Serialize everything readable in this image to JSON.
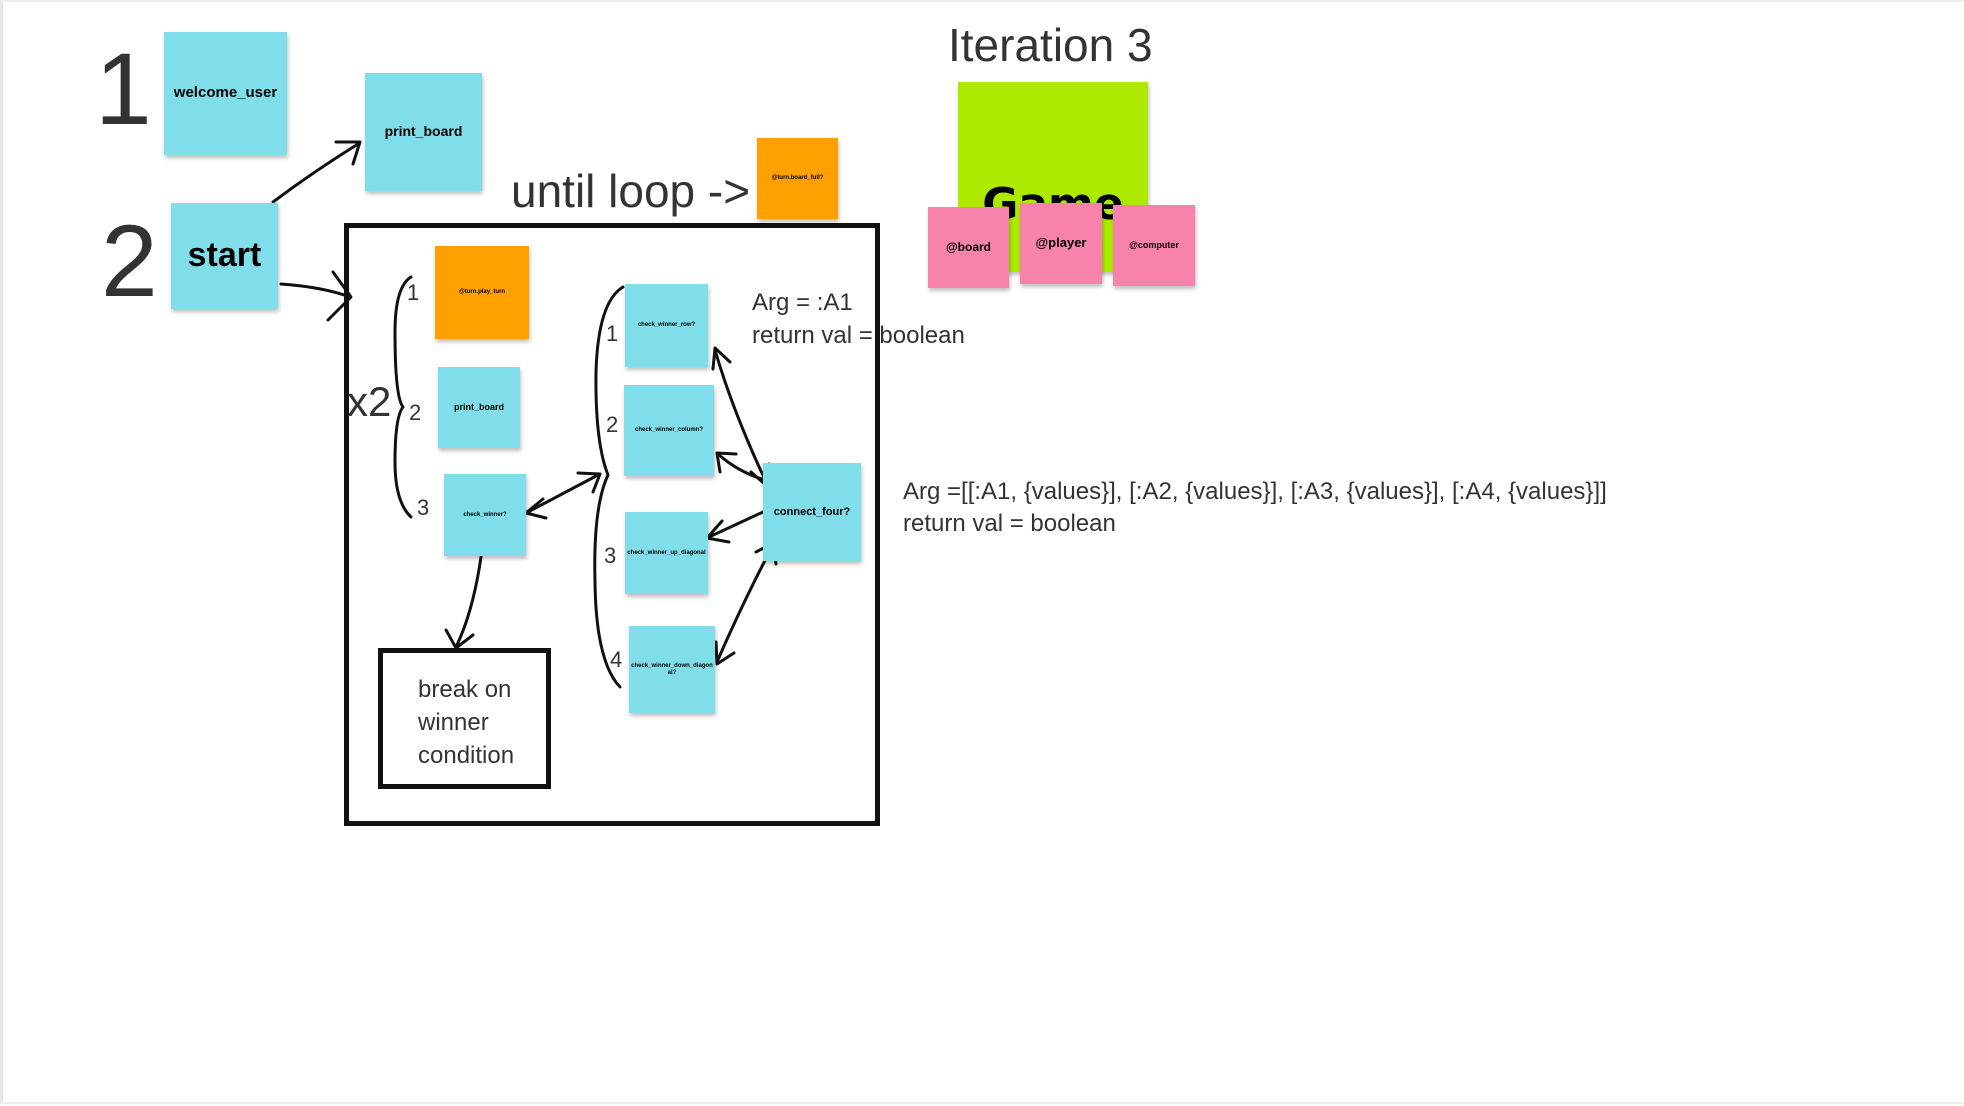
{
  "title": "Iteration 3",
  "step_numbers": {
    "one": "1",
    "two": "2"
  },
  "notes": {
    "welcome_user": "welcome_user",
    "print_board_top": "print_board",
    "start": "start",
    "board_full": "@turn.board_full?",
    "play_turn": "@turn.play_turn",
    "print_board_inner": "print_board",
    "check_winner": "check_winner?",
    "check_winner_row": "check_winner_row?",
    "check_winner_column": "check_winner_column?",
    "check_winner_up_diagonal": "check_winner_up_diagonal",
    "check_winner_down_diagonal": "check_winner_down_diagonal?",
    "connect_four": "connect_four?",
    "game": "Game",
    "board_attr": "@board",
    "player_attr": "@player",
    "computer_attr": "@computer"
  },
  "labels": {
    "until_loop": "until loop ->",
    "x2": "x2",
    "turn_1": "1",
    "turn_2": "2",
    "turn_3": "3",
    "check_1": "1",
    "check_2": "2",
    "check_3": "3",
    "check_4": "4",
    "break_on_winner": "break on winner condition",
    "arg_a1": "Arg = :A1",
    "return_val_1": "return val = boolean",
    "arg_values": "Arg =[[:A1, {values}], [:A2, {values}], [:A3, {values}], [:A4, {values}]]",
    "return_val_2": "return val = boolean"
  },
  "colors": {
    "sticky_cyan": "#80deea",
    "sticky_orange": "#ff9f00",
    "sticky_pink": "#f783ac",
    "sticky_green": "#aeea00",
    "ink": "#111111"
  }
}
